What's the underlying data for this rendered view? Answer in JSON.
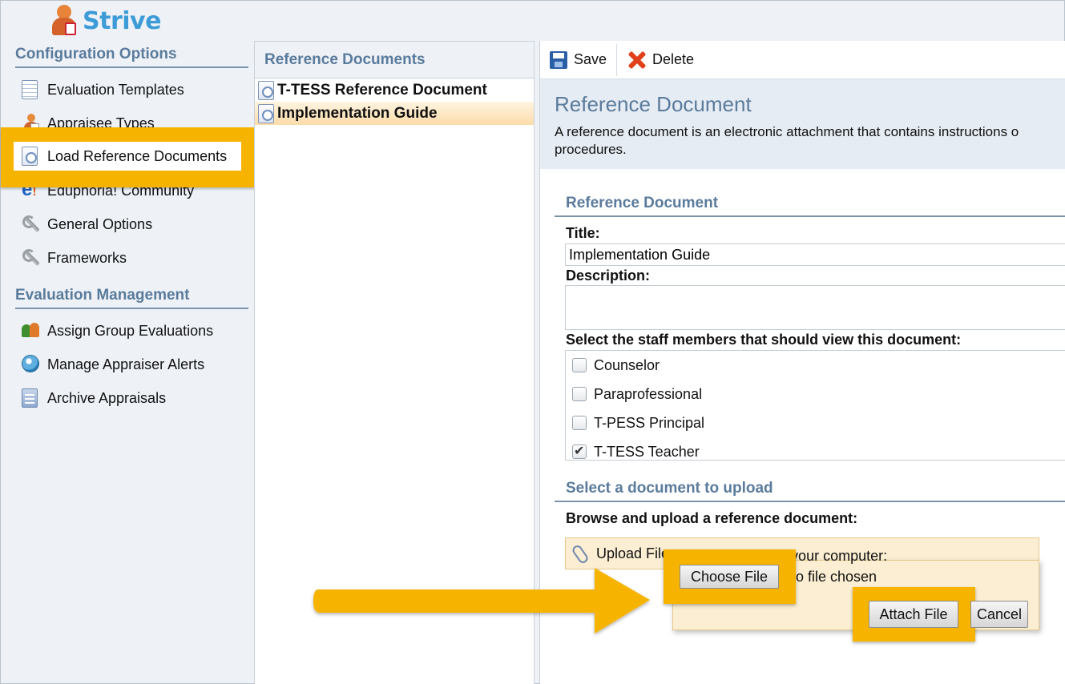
{
  "app": {
    "name": "Strive"
  },
  "sidebar": {
    "sections": [
      {
        "title": "Configuration Options"
      },
      {
        "title": "Evaluation Management"
      }
    ],
    "config_items": [
      {
        "label": "Evaluation Templates",
        "icon": "template-icon"
      },
      {
        "label": "Appraisee Types",
        "icon": "people-icon"
      },
      {
        "label": "Load Reference Documents",
        "icon": "document-icon"
      },
      {
        "label": "Eduphoria! Community",
        "icon": "eduphoria-icon"
      },
      {
        "label": "General Options",
        "icon": "wrench-icon"
      },
      {
        "label": "Frameworks",
        "icon": "wrench-icon"
      }
    ],
    "management_items": [
      {
        "label": "Assign Group Evaluations",
        "icon": "group-icon"
      },
      {
        "label": "Manage Appraiser Alerts",
        "icon": "alert-icon"
      },
      {
        "label": "Archive Appraisals",
        "icon": "archive-icon"
      }
    ]
  },
  "list": {
    "header": "Reference Documents",
    "items": [
      {
        "label": "T-TESS Reference Document",
        "selected": false
      },
      {
        "label": "Implementation Guide",
        "selected": true
      }
    ]
  },
  "toolbar": {
    "save_label": "Save",
    "delete_label": "Delete"
  },
  "detail": {
    "title": "Reference Document",
    "description_line1": "A reference document is an electronic attachment that contains instructions o",
    "description_line2": "procedures.",
    "section_reference": "Reference Document",
    "title_label": "Title:",
    "title_value": "Implementation Guide",
    "description_label": "Description:",
    "description_value": "",
    "staff_label": "Select the staff members that should view this document:",
    "staff": [
      {
        "label": "Counselor",
        "checked": false
      },
      {
        "label": "Paraprofessional",
        "checked": false
      },
      {
        "label": "T-PESS Principal",
        "checked": false
      },
      {
        "label": "T-TESS Teacher",
        "checked": true
      }
    ],
    "section_upload": "Select a document to upload",
    "browse_label": "Browse and upload a reference document:",
    "upload_file_label": "Upload File",
    "upload_hint": "Select a file from your computer:"
  },
  "dialog": {
    "choose_file_label": "Choose File",
    "no_file_text": "No file chosen",
    "attach_label": "Attach File",
    "cancel_label": "Cancel"
  },
  "colors": {
    "accent": "#5a7b9c",
    "highlight": "#f6b300",
    "brand": "#3d9bd8"
  }
}
